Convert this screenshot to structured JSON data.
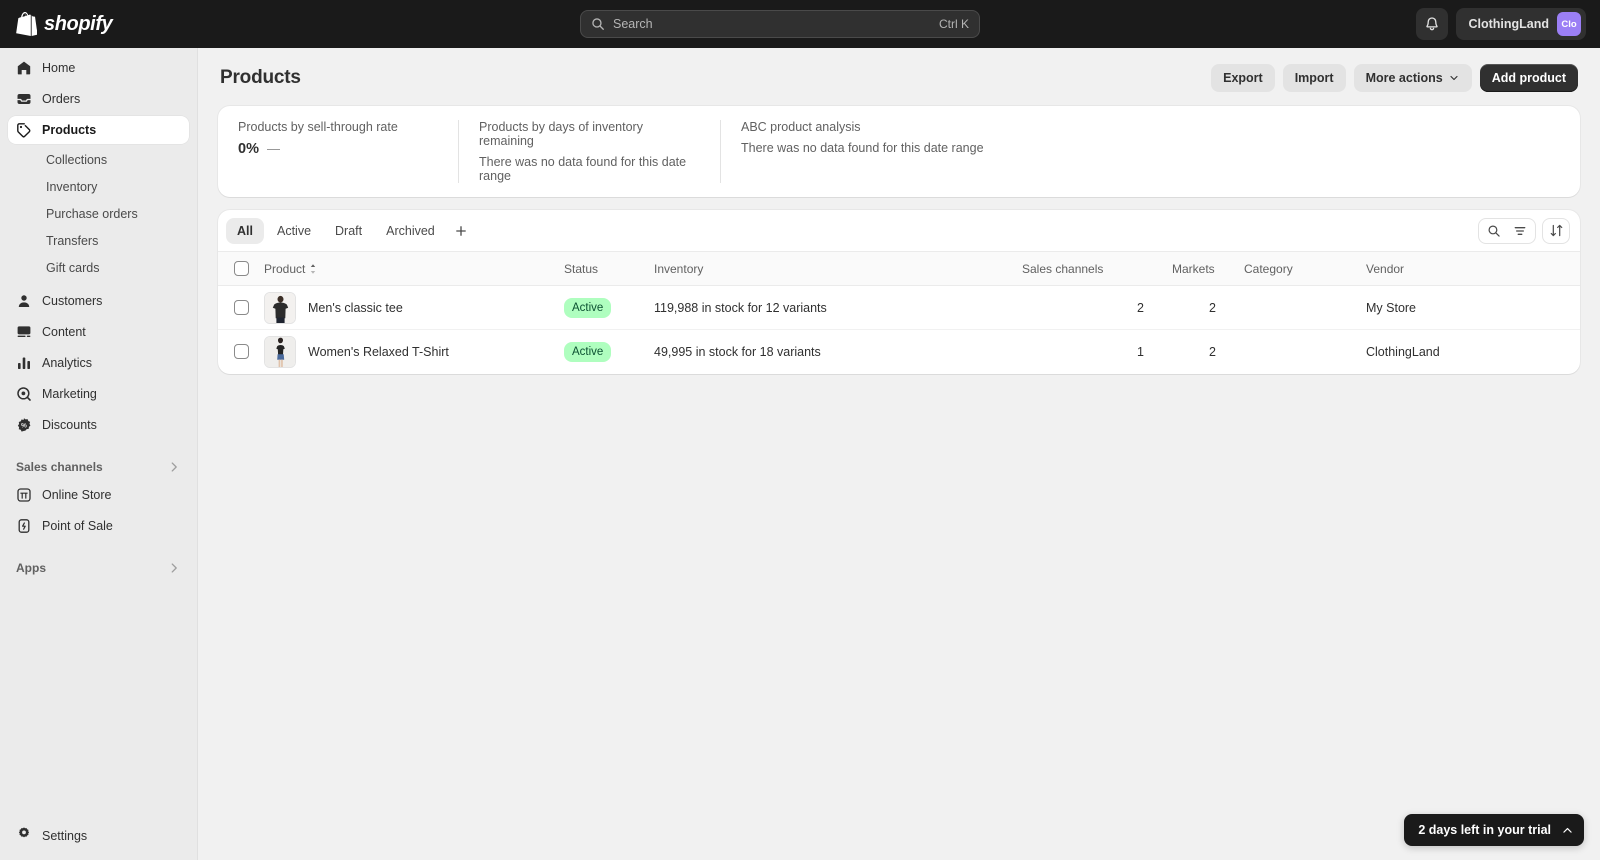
{
  "topbar": {
    "brand": "shopify",
    "search": {
      "placeholder": "Search",
      "shortcut": "Ctrl K",
      "icon": "search-icon"
    },
    "notifications_icon": "bell-icon",
    "store_name": "ClothingLand",
    "store_avatar_initials": "Clo",
    "avatar_color": "#9b7ff5"
  },
  "sidebar": {
    "items": [
      {
        "label": "Home",
        "icon": "home-icon",
        "selected": false
      },
      {
        "label": "Orders",
        "icon": "orders-icon",
        "selected": false
      },
      {
        "label": "Products",
        "icon": "products-tag-icon",
        "selected": true
      }
    ],
    "subitems": [
      {
        "label": "Collections"
      },
      {
        "label": "Inventory"
      },
      {
        "label": "Purchase orders"
      },
      {
        "label": "Transfers"
      },
      {
        "label": "Gift cards"
      }
    ],
    "items2": [
      {
        "label": "Customers",
        "icon": "customers-icon"
      },
      {
        "label": "Content",
        "icon": "content-icon"
      },
      {
        "label": "Analytics",
        "icon": "analytics-icon"
      },
      {
        "label": "Marketing",
        "icon": "marketing-icon"
      },
      {
        "label": "Discounts",
        "icon": "discounts-icon"
      }
    ],
    "sales_channels": {
      "label": "Sales channels",
      "chevron_icon": "chevron-right-icon",
      "items": [
        {
          "label": "Online Store",
          "icon": "online-store-icon"
        },
        {
          "label": "Point of Sale",
          "icon": "point-of-sale-icon"
        }
      ]
    },
    "apps": {
      "label": "Apps",
      "chevron_icon": "chevron-right-icon"
    },
    "settings": {
      "label": "Settings",
      "icon": "gear-icon"
    }
  },
  "page": {
    "title": "Products",
    "actions": {
      "export": "Export",
      "import": "Import",
      "more_actions": "More actions",
      "more_actions_icon": "chevron-down-icon",
      "add_product": "Add product"
    }
  },
  "metrics": [
    {
      "label": "Products by sell-through rate",
      "value": "0%",
      "delta": "—",
      "empty": ""
    },
    {
      "label": "Products by days of inventory remaining",
      "value": "",
      "delta": "",
      "empty": "There was no data found for this date range"
    },
    {
      "label": "ABC product analysis",
      "value": "",
      "delta": "",
      "empty": "There was no data found for this date range"
    }
  ],
  "tabs": {
    "items": [
      {
        "label": "All",
        "active": true
      },
      {
        "label": "Active",
        "active": false
      },
      {
        "label": "Draft",
        "active": false
      },
      {
        "label": "Archived",
        "active": false
      }
    ],
    "add_label": "+",
    "tools": {
      "search_icon": "search-icon",
      "filter_icon": "filter-icon",
      "sort_icon": "sort-icon"
    }
  },
  "table": {
    "columns": {
      "product": "Product",
      "status": "Status",
      "inventory": "Inventory",
      "sales_channels": "Sales channels",
      "markets": "Markets",
      "category": "Category",
      "vendor": "Vendor"
    },
    "sort_icon": "sort-caret-icon",
    "rows": [
      {
        "product": "Men's classic tee",
        "status": "Active",
        "inventory": "119,988 in stock for 12 variants",
        "sales_channels": "2",
        "markets": "2",
        "category": "",
        "vendor": "My Store",
        "thumb": "mens-tee-thumbnail"
      },
      {
        "product": "Women's Relaxed T-Shirt",
        "status": "Active",
        "inventory": "49,995 in stock for 18 variants",
        "sales_channels": "1",
        "markets": "2",
        "category": "",
        "vendor": "ClothingLand",
        "thumb": "womens-tshirt-thumbnail"
      }
    ]
  },
  "trial": {
    "text": "2 days left in your trial",
    "icon": "chevron-up-icon"
  },
  "colors": {
    "status_badge_bg": "#affebf",
    "status_badge_text": "#0c5132",
    "primary_button": "#303030"
  }
}
